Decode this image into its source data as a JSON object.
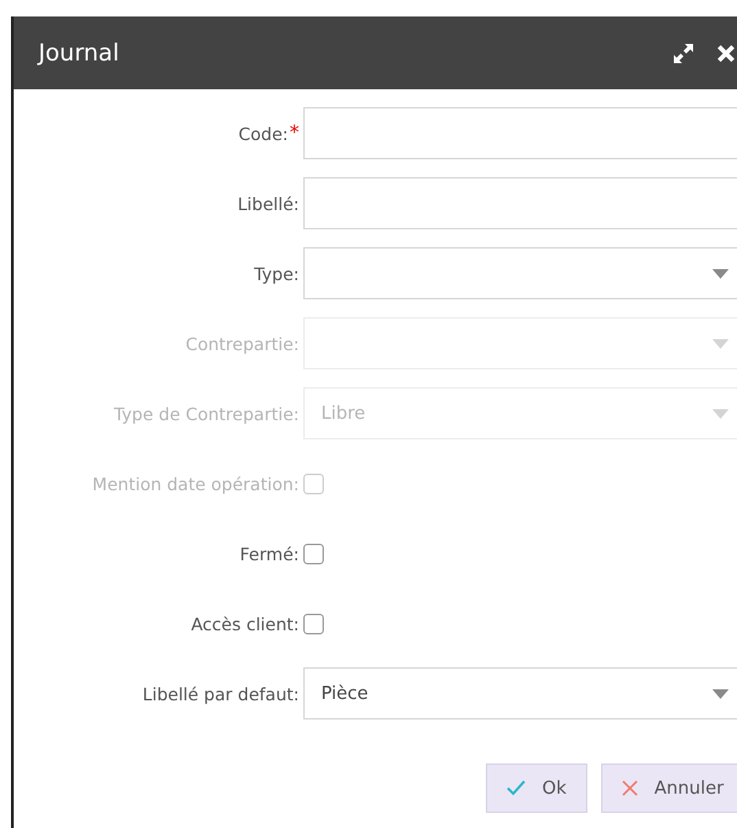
{
  "window": {
    "title": "Journal"
  },
  "fields": [
    {
      "kind": "text",
      "label": "Code:",
      "required_mark": "*",
      "disabled": false
    },
    {
      "kind": "text",
      "label": "Libellé:",
      "disabled": false
    },
    {
      "kind": "select",
      "label": "Type:",
      "disabled": false
    },
    {
      "kind": "select",
      "label": "Contrepartie:",
      "disabled": true
    },
    {
      "kind": "select",
      "label": "Type de Contrepartie:",
      "value": "Libre",
      "disabled": true
    },
    {
      "kind": "checkbox",
      "label": "Mention date opération:",
      "checked": false,
      "disabled": true
    },
    {
      "kind": "checkbox",
      "label": "Fermé:",
      "checked": false,
      "disabled": false
    },
    {
      "kind": "checkbox",
      "label": "Accès client:",
      "checked": false,
      "disabled": false
    },
    {
      "kind": "select",
      "label": "Libellé par defaut:",
      "value": "Pièce",
      "disabled": false
    }
  ],
  "buttons": [
    {
      "kind": "ok",
      "label": "Ok"
    },
    {
      "kind": "cancel",
      "label": "Annuler"
    }
  ]
}
